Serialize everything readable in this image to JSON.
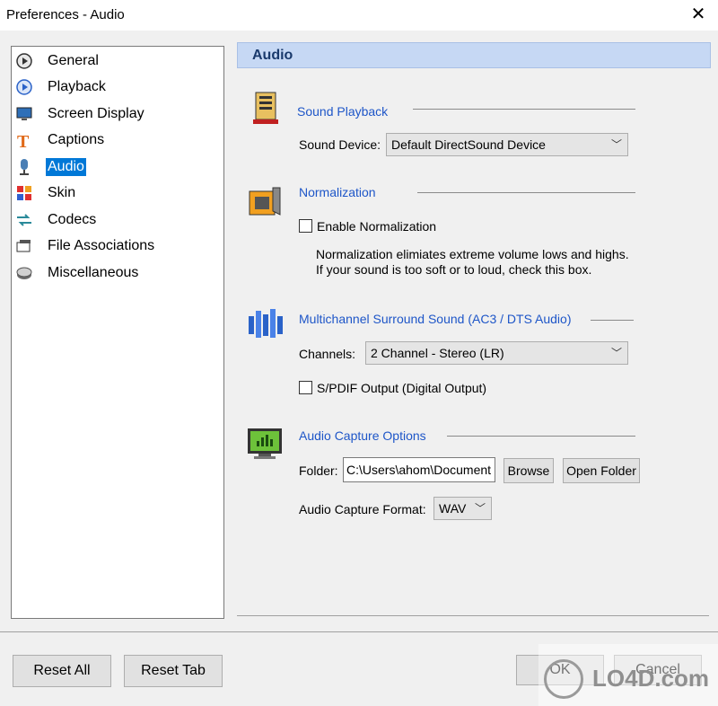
{
  "window": {
    "title": "Preferences - Audio",
    "close_glyph": "✕"
  },
  "sidebar": {
    "items": [
      {
        "label": "General",
        "icon": "general-icon",
        "color": "#3a73c4"
      },
      {
        "label": "Playback",
        "icon": "playback-icon",
        "color": "#2a62c8"
      },
      {
        "label": "Screen Display",
        "icon": "monitor-icon",
        "color": "#2e6fb8"
      },
      {
        "label": "Captions",
        "icon": "captions-icon",
        "color": "#e06a1a"
      },
      {
        "label": "Audio",
        "icon": "microphone-icon",
        "color": "#4a7fb5",
        "selected": true
      },
      {
        "label": "Skin",
        "icon": "skin-icon",
        "color": "#e03030"
      },
      {
        "label": "Codecs",
        "icon": "codecs-icon",
        "color": "#2a8a9a"
      },
      {
        "label": "File Associations",
        "icon": "file-associations-icon",
        "color": "#555555"
      },
      {
        "label": "Miscellaneous",
        "icon": "miscellaneous-icon",
        "color": "#6a6a6a"
      }
    ]
  },
  "header": {
    "title": "Audio"
  },
  "sound_playback": {
    "title": "Sound Playback",
    "device_label": "Sound Device:",
    "device_value": "Default DirectSound Device"
  },
  "normalization": {
    "title": "Normalization",
    "checkbox_label": "Enable Normalization",
    "checked": false,
    "desc_line1": "Normalization elimiates extreme volume lows and highs.",
    "desc_line2": "If your sound is too soft or to loud, check this box."
  },
  "surround": {
    "title": "Multichannel Surround Sound (AC3 / DTS Audio)",
    "channels_label": "Channels:",
    "channels_value": "2 Channel - Stereo (LR)",
    "spdif_label": "S/PDIF Output (Digital Output)",
    "spdif_checked": false
  },
  "capture": {
    "title": "Audio Capture Options",
    "folder_label": "Folder:",
    "folder_value": "C:\\Users\\ahom\\Document",
    "browse_label": "Browse",
    "open_folder_label": "Open Folder",
    "format_label": "Audio Capture Format:",
    "format_value": "WAV"
  },
  "footer": {
    "reset_all": "Reset All",
    "reset_tab": "Reset Tab",
    "ok": "OK",
    "cancel": "Cancel"
  },
  "watermark": {
    "text": "LO4D.com"
  }
}
